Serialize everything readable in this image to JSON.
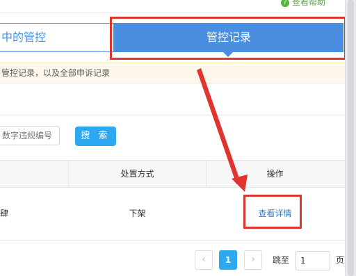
{
  "top_link": {
    "label": "查看帮助"
  },
  "tabs": [
    {
      "label": "中的管控"
    },
    {
      "label": "管控记录"
    }
  ],
  "notice": {
    "text": "管控记录，以及全部申诉记录"
  },
  "search": {
    "placeholder": "数字违规编号",
    "button_label": "搜 索"
  },
  "table": {
    "headers": [
      "",
      "处置方式",
      "操作"
    ],
    "rows": [
      {
        "col1": "肆",
        "disposal": "下架",
        "action": "查看详情"
      }
    ]
  },
  "pagination": {
    "prev": "‹",
    "current": "1",
    "next": "›",
    "jump_label": "跳至",
    "jump_value": "1",
    "unit": "页"
  },
  "colors": {
    "accent": "#4a8fdf",
    "button": "#2ea8f0",
    "annotation": "#e0352f",
    "link": "#2d7fd3"
  }
}
